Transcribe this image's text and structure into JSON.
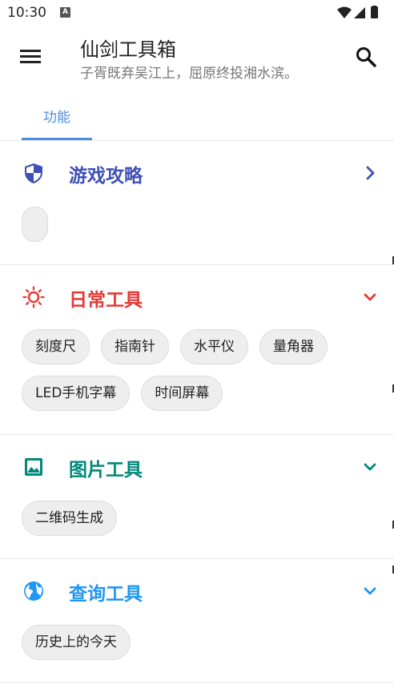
{
  "status_bar": {
    "time": "10:30",
    "notification_letter": "A"
  },
  "app_bar": {
    "title": "仙剑工具箱",
    "subtitle": "子胥既弃吴江上，屈原终投湘水滨。",
    "menu_icon": "menu-icon",
    "search_icon": "search-icon"
  },
  "tabs": [
    {
      "label": "功能",
      "selected": true
    }
  ],
  "colors": {
    "accent": "#4a8fdd",
    "game_guide": "#3f51b5",
    "daily_tools": "#e53935",
    "image_tools": "#00897b",
    "query_tools": "#2196f3"
  },
  "sections": [
    {
      "title": "游戏攻略",
      "icon": "shield-icon",
      "chevron": "chevron-right-icon",
      "items": []
    },
    {
      "title": "日常工具",
      "icon": "sun-icon",
      "chevron": "chevron-down-icon",
      "items": [
        "刻度尺",
        "指南针",
        "水平仪",
        "量角器",
        "LED手机字幕",
        "时间屏幕"
      ]
    },
    {
      "title": "图片工具",
      "icon": "image-icon",
      "chevron": "chevron-down-icon",
      "items": [
        "二维码生成"
      ]
    },
    {
      "title": "查询工具",
      "icon": "globe-icon",
      "chevron": "chevron-down-icon",
      "items": [
        "历史上的今天"
      ]
    }
  ]
}
